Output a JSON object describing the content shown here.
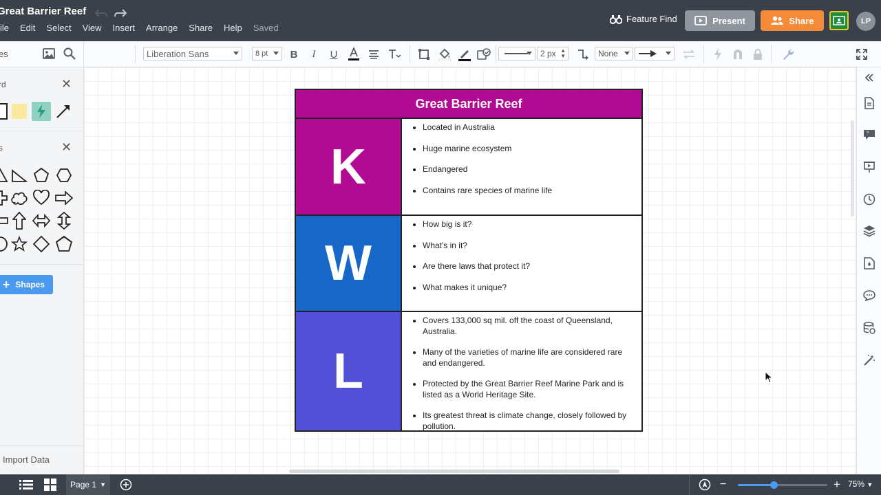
{
  "header": {
    "doc_title": "Great Barrier Reef",
    "menu": [
      "ile",
      "Edit",
      "Select",
      "View",
      "Insert",
      "Arrange",
      "Share",
      "Help"
    ],
    "saved_status": "Saved",
    "feature_find": "Feature Find",
    "present": "Present",
    "share": "Share",
    "avatar_initials": "LP"
  },
  "toolbar": {
    "font_family": "Liberation Sans",
    "font_size": "8 pt",
    "line_width": "2 px",
    "arrow_start": "None"
  },
  "left_panel": {
    "section1_title": "rd",
    "section2_title": "s",
    "top_label": "es",
    "shapes_button": "Shapes",
    "import_data": "Import Data"
  },
  "kwl": {
    "title": "Great Barrier Reef",
    "colors": {
      "title": "#b10a93",
      "k": "#b10a93",
      "w": "#1767c9",
      "l": "#5150d6"
    },
    "rows": [
      {
        "letter": "K",
        "items": [
          "Located in Australia",
          "Huge marine ecosystem",
          "Endangered",
          "Contains rare species of marine life"
        ]
      },
      {
        "letter": "W",
        "items": [
          "How big is it?",
          "What's in it?",
          "Are there laws that protect it?",
          "What makes it unique?"
        ]
      },
      {
        "letter": "L",
        "items": [
          "Covers 133,000 sq mil. off the coast of Queensland, Australia.",
          "Many of the varieties of marine life are considered rare and endangered.",
          "Protected by the Great Barrier Reef Marine Park and is listed as a World Heritage Site.",
          "Its greatest threat is climate change, closely followed by pollution."
        ]
      }
    ]
  },
  "bottom": {
    "page_tab": "Page 1",
    "zoom": "75%",
    "zoom_fraction": 0.4
  }
}
